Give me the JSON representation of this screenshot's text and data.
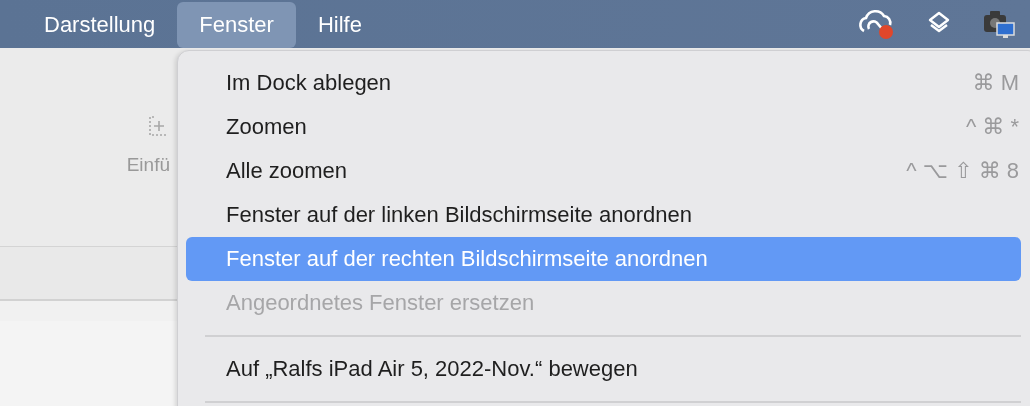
{
  "menu_bar": {
    "items": [
      {
        "label": "Darstellung",
        "selected": false
      },
      {
        "label": "Fenster",
        "selected": true
      },
      {
        "label": "Hilfe",
        "selected": false
      }
    ]
  },
  "background_window": {
    "toolbar_button": {
      "label": "Einfü"
    }
  },
  "menu": {
    "items": [
      {
        "kind": "item",
        "label": "Im Dock ablegen",
        "shortcut": "⌘ M",
        "selected": false,
        "disabled": false
      },
      {
        "kind": "item",
        "label": "Zoomen",
        "shortcut": "^ ⌘ *",
        "selected": false,
        "disabled": false
      },
      {
        "kind": "item",
        "label": "Alle zoomen",
        "shortcut": "^ ⌥ ⇧ ⌘ 8",
        "selected": false,
        "disabled": false
      },
      {
        "kind": "item",
        "label": "Fenster auf der linken Bildschirmseite anordnen",
        "selected": false,
        "disabled": false
      },
      {
        "kind": "item",
        "label": "Fenster auf der rechten Bildschirmseite anordnen",
        "selected": true,
        "disabled": false
      },
      {
        "kind": "item",
        "label": "Angeordnetes Fenster ersetzen",
        "selected": false,
        "disabled": true
      },
      {
        "kind": "separator"
      },
      {
        "kind": "item",
        "label": "Auf „Ralfs iPad Air 5, 2022-Nov.“ bewegen",
        "selected": false,
        "disabled": false
      },
      {
        "kind": "separator"
      }
    ]
  }
}
